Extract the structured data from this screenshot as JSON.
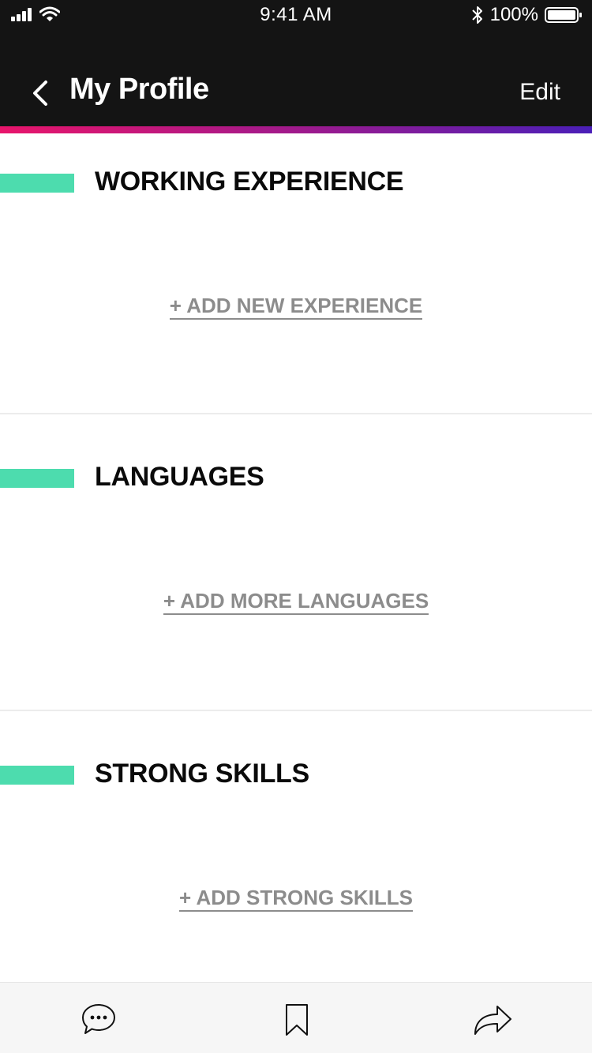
{
  "status_bar": {
    "time": "9:41 AM",
    "battery": "100%",
    "icons": [
      "signal-icon",
      "wifi-icon",
      "bluetooth-icon",
      "battery-icon"
    ]
  },
  "nav": {
    "title": "My Profile",
    "edit_label": "Edit",
    "back_icon": "chevron-left-icon"
  },
  "colors": {
    "header_bg": "#141414",
    "accent": "#4ddcae",
    "gradient_start": "#e8156b",
    "gradient_end": "#4a1fb8",
    "link_gray": "#8c8c8c"
  },
  "sections": [
    {
      "title": "WORKING EXPERIENCE",
      "action": "+ ADD NEW EXPERIENCE"
    },
    {
      "title": "LANGUAGES",
      "action": "+ ADD MORE LANGUAGES"
    },
    {
      "title": "STRONG SKILLS",
      "action": "+ ADD STRONG SKILLS"
    }
  ],
  "tab_bar": {
    "items": [
      "chat-bubble-icon",
      "bookmark-icon",
      "share-icon"
    ]
  }
}
